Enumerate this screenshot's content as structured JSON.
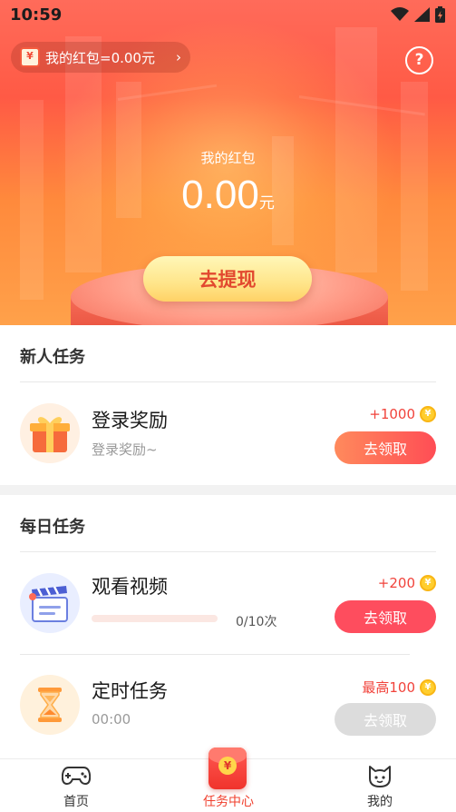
{
  "status_bar": {
    "time": "10:59"
  },
  "header": {
    "wallet_pill_label": "我的红包=0.00元",
    "wallet_icon_glyph": "¥",
    "help_glyph": "?"
  },
  "hero": {
    "title": "我的红包",
    "amount": "0.00",
    "unit": "元",
    "withdraw_label": "去提现"
  },
  "new_tasks": {
    "title": "新人任务",
    "items": [
      {
        "title": "登录奖励",
        "subtitle": "登录奖励~",
        "reward": "+1000",
        "button": "去领取",
        "icon": "gift-icon"
      }
    ]
  },
  "daily_tasks": {
    "title": "每日任务",
    "items": [
      {
        "title": "观看视频",
        "reward": "+200",
        "button": "去领取",
        "progress_text": "0/10次",
        "progress": 0,
        "icon": "video-clapper-icon"
      },
      {
        "title": "定时任务",
        "subtitle": "00:00",
        "reward": "最高100",
        "button": "去领取",
        "icon": "hourglass-icon"
      }
    ]
  },
  "coin_glyph": "¥",
  "nav": {
    "items": [
      {
        "label": "首页",
        "icon": "gamepad-icon"
      },
      {
        "label": "任务中心",
        "icon": "red-envelope-icon"
      },
      {
        "label": "我的",
        "icon": "cat-face-icon"
      }
    ],
    "active_index": 1
  },
  "colors": {
    "accent": "#f0402e",
    "hero_top": "#ff6b5a",
    "hero_bottom": "#ffa14a",
    "withdraw_button": "#ffe58a",
    "reward_text": "#f1433b",
    "claim_active": "#fe4d5e",
    "claim_disabled": "#dcdcdc"
  }
}
